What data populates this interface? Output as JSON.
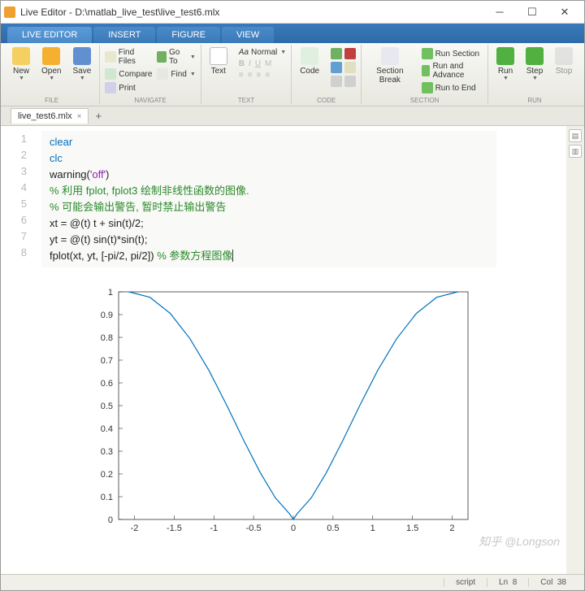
{
  "window": {
    "title": "Live Editor - D:\\matlab_live_test\\live_test6.mlx"
  },
  "tabs": [
    {
      "label": "LIVE EDITOR",
      "active": true
    },
    {
      "label": "INSERT"
    },
    {
      "label": "FIGURE"
    },
    {
      "label": "VIEW"
    }
  ],
  "ribbon": {
    "file": {
      "new": "New",
      "open": "Open",
      "save": "Save",
      "label": "FILE"
    },
    "nav": {
      "findfiles": "Find Files",
      "compare": "Compare",
      "print": "Print",
      "goto": "Go To",
      "find": "Find",
      "label": "NAVIGATE"
    },
    "text": {
      "text": "Text",
      "normal": "Normal",
      "label": "TEXT"
    },
    "code": {
      "code": "Code",
      "label": "CODE"
    },
    "section": {
      "break": "Section Break",
      "runsection": "Run Section",
      "runadvance": "Run and Advance",
      "runend": "Run to End",
      "label": "SECTION"
    },
    "run": {
      "run": "Run",
      "step": "Step",
      "stop": "Stop",
      "label": "RUN"
    }
  },
  "file_tab": {
    "name": "live_test6.mlx"
  },
  "code": {
    "lines": [
      1,
      2,
      3,
      4,
      5,
      6,
      7,
      8
    ],
    "l1": "clear",
    "l2": "clc",
    "l3a": "warning(",
    "l3b": "'off'",
    "l3c": ")",
    "l4": "% 利用 fplot, fplot3 绘制非线性函数的图像.",
    "l5": "% 可能会输出警告, 暂时禁止输出警告",
    "l6": "xt = @(t) t + sin(t)/2;",
    "l7": "yt = @(t) sin(t)*sin(t);",
    "l8a": "fplot(xt, yt, [-pi/2, pi/2]) ",
    "l8b": "% 参数方程图像"
  },
  "chart_data": {
    "type": "line",
    "param": "t in [-pi/2, pi/2]",
    "x_expr": "t + sin(t)/2",
    "y_expr": "sin(t)^2",
    "x": [
      -2.071,
      -1.806,
      -1.549,
      -1.301,
      -1.063,
      -0.836,
      -0.621,
      -0.417,
      -0.226,
      -0.046,
      0,
      0.046,
      0.226,
      0.417,
      0.621,
      0.836,
      1.063,
      1.301,
      1.549,
      1.806,
      2.071
    ],
    "y": [
      1.0,
      0.976,
      0.905,
      0.794,
      0.655,
      0.5,
      0.345,
      0.206,
      0.095,
      0.024,
      0,
      0.024,
      0.095,
      0.206,
      0.345,
      0.5,
      0.655,
      0.794,
      0.905,
      0.976,
      1.0
    ],
    "xticks": [
      -2,
      -1.5,
      -1,
      -0.5,
      0,
      0.5,
      1,
      1.5,
      2
    ],
    "yticks": [
      0,
      0.1,
      0.2,
      0.3,
      0.4,
      0.5,
      0.6,
      0.7,
      0.8,
      0.9,
      1
    ],
    "xlim": [
      -2.2,
      2.2
    ],
    "ylim": [
      0,
      1
    ]
  },
  "status": {
    "mode": "script",
    "ln": "Ln",
    "ln_v": "8",
    "col": "Col",
    "col_v": "38"
  },
  "watermark": "知乎 @Longson"
}
